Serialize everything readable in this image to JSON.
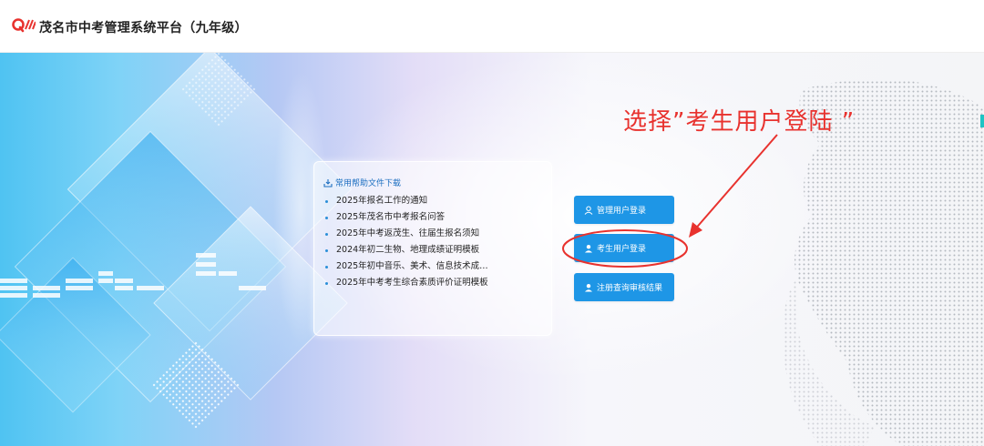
{
  "header": {
    "logo_icon": "brand-logo",
    "title": "茂名市中考管理系统平台（九年级）"
  },
  "annotation": {
    "text": "选择”考生用户登陆 ”",
    "color": "#e8322e"
  },
  "help_panel": {
    "header_icon": "download-icon",
    "header": "常用帮助文件下载",
    "items": [
      "2025年报名工作的通知",
      "2025年茂名市中考报名问答",
      "2025年中考返茂生、往届生报名须知",
      "2024年初二生物、地理成绩证明模板",
      "2025年初中音乐、美术、信息技术成…",
      "2025年中考考生综合素质评价证明模板"
    ]
  },
  "login_buttons": [
    {
      "label": "管理用户登录",
      "icon": "admin-user-icon"
    },
    {
      "label": "考生用户登录",
      "icon": "student-user-icon"
    },
    {
      "label": "注册查询审核结果",
      "icon": "register-user-icon"
    }
  ],
  "colors": {
    "accent": "#1e96e6",
    "link": "#1c6fc1",
    "logo_red": "#e8322e",
    "bullet": "#2a8fd8"
  }
}
